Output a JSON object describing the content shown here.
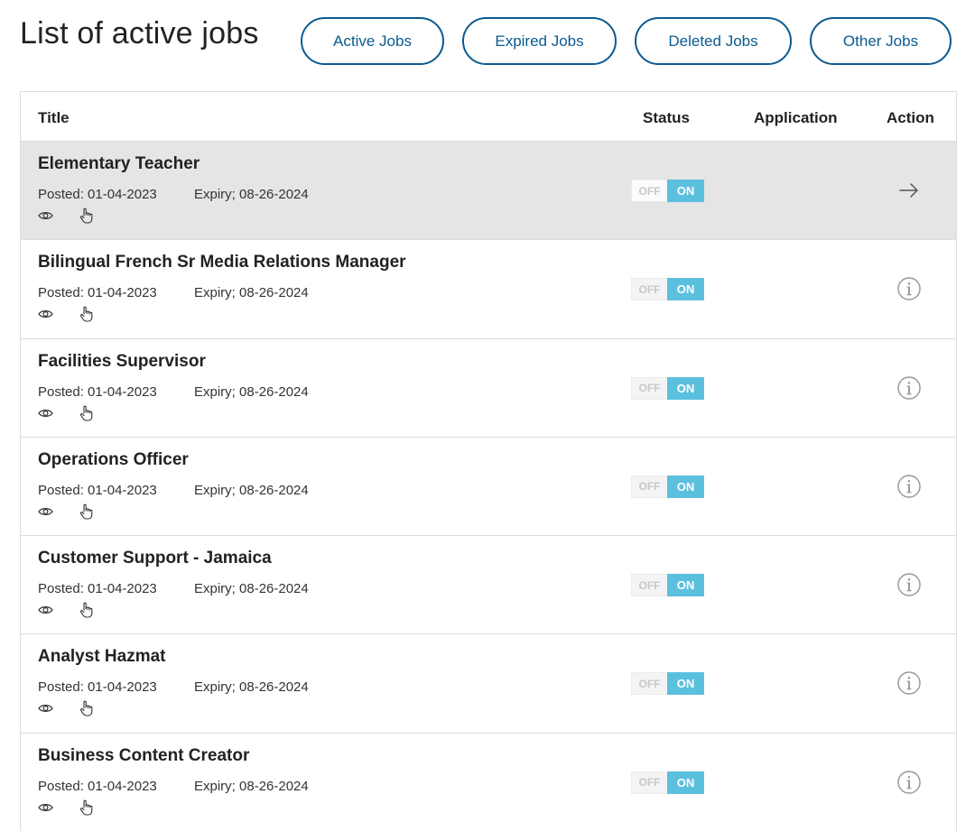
{
  "page": {
    "title": "List of active jobs"
  },
  "filters": {
    "active": "Active Jobs",
    "expired": "Expired Jobs",
    "deleted": "Deleted Jobs",
    "other": "Other Jobs"
  },
  "table": {
    "columns": {
      "title": "Title",
      "status": "Status",
      "application": "Application",
      "action": "Action"
    },
    "toggle": {
      "off_label": "OFF",
      "on_label": "ON"
    },
    "labels": {
      "posted": "Posted: ",
      "expiry": "Expiry; "
    },
    "icons": {
      "view": "eye-icon",
      "click": "pointer-hand-icon",
      "open": "arrow-right-icon",
      "info": "info-icon"
    },
    "colors": {
      "accent": "#0b5a8f",
      "toggle_on": "#5bc0de",
      "highlight_row": "#e5e5e5"
    },
    "rows": [
      {
        "title": "Elementary Teacher",
        "posted": "01-04-2023",
        "expiry": "08-26-2024",
        "status": "ON",
        "action_icon": "arrow-right-icon",
        "highlighted": true
      },
      {
        "title": "Bilingual French Sr Media Relations Manager",
        "posted": "01-04-2023",
        "expiry": "08-26-2024",
        "status": "ON",
        "action_icon": "info-icon",
        "highlighted": false
      },
      {
        "title": "Facilities Supervisor",
        "posted": "01-04-2023",
        "expiry": "08-26-2024",
        "status": "ON",
        "action_icon": "info-icon",
        "highlighted": false
      },
      {
        "title": "Operations Officer",
        "posted": "01-04-2023",
        "expiry": "08-26-2024",
        "status": "ON",
        "action_icon": "info-icon",
        "highlighted": false
      },
      {
        "title": "Customer Support - Jamaica",
        "posted": "01-04-2023",
        "expiry": "08-26-2024",
        "status": "ON",
        "action_icon": "info-icon",
        "highlighted": false
      },
      {
        "title": "Analyst Hazmat",
        "posted": "01-04-2023",
        "expiry": "08-26-2024",
        "status": "ON",
        "action_icon": "info-icon",
        "highlighted": false
      },
      {
        "title": "Business Content Creator",
        "posted": "01-04-2023",
        "expiry": "08-26-2024",
        "status": "ON",
        "action_icon": "info-icon",
        "highlighted": false
      }
    ]
  }
}
